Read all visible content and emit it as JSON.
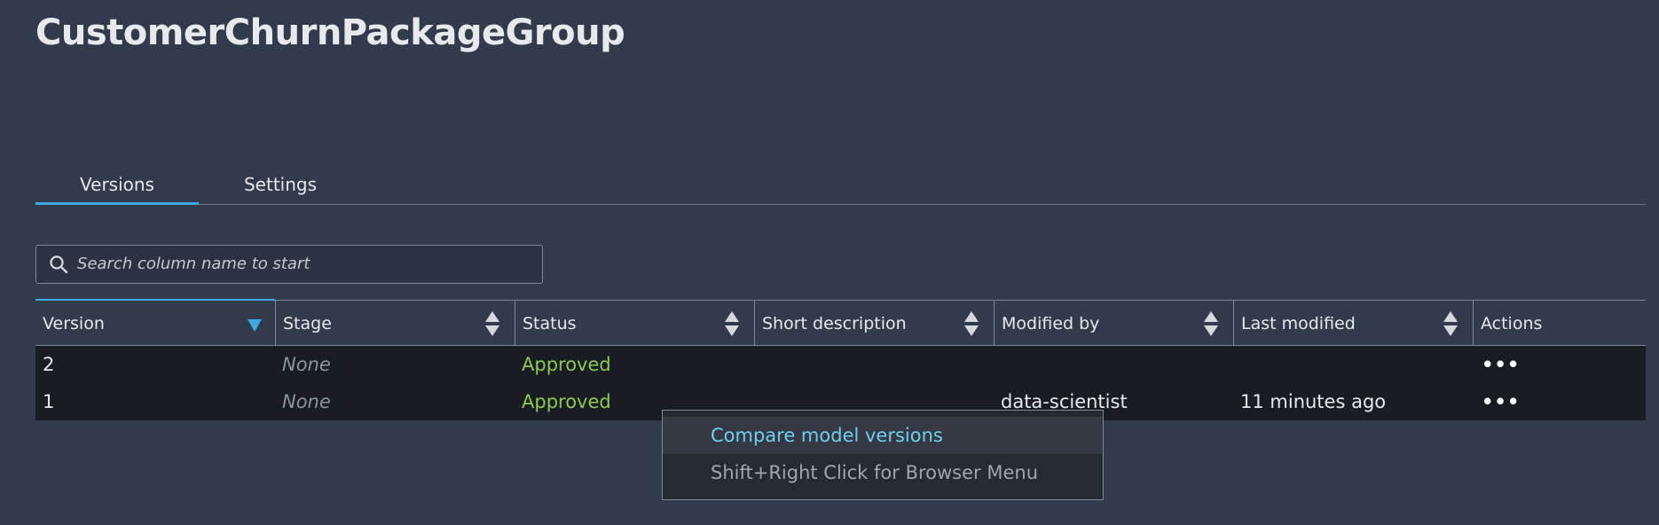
{
  "header": {
    "title": "CustomerChurnPackageGroup"
  },
  "tabs": [
    {
      "label": "Versions",
      "active": true
    },
    {
      "label": "Settings",
      "active": false
    }
  ],
  "search": {
    "placeholder": "Search column name to start",
    "value": ""
  },
  "table": {
    "columns": [
      {
        "label": "Version",
        "sorted": "descending"
      },
      {
        "label": "Stage"
      },
      {
        "label": "Status"
      },
      {
        "label": "Short description"
      },
      {
        "label": "Modified by"
      },
      {
        "label": "Last modified"
      },
      {
        "label": "Actions"
      }
    ],
    "rows": [
      {
        "version": "2",
        "stage": "None",
        "status": "Approved",
        "short_description": "",
        "modified_by": "",
        "last_modified": "",
        "actions": "•••"
      },
      {
        "version": "1",
        "stage": "None",
        "status": "Approved",
        "short_description": "",
        "modified_by": "data-scientist",
        "last_modified": "11 minutes ago",
        "actions": "•••"
      }
    ]
  },
  "context_menu": {
    "items": [
      {
        "label": "Compare model versions",
        "highlighted": true
      },
      {
        "label": "Shift+Right Click for Browser Menu",
        "highlighted": false
      }
    ]
  },
  "colors": {
    "background": "#323b4c",
    "accent": "#3ea8df",
    "status_approved": "#8ec84e",
    "menu_highlight_text": "#6ed0ed",
    "table_body": "#191c22"
  },
  "icons": {
    "search": "search-icon",
    "sort_descending": "sort-descending-icon",
    "sort": "sort-icon",
    "actions": "more-horizontal-icon"
  }
}
